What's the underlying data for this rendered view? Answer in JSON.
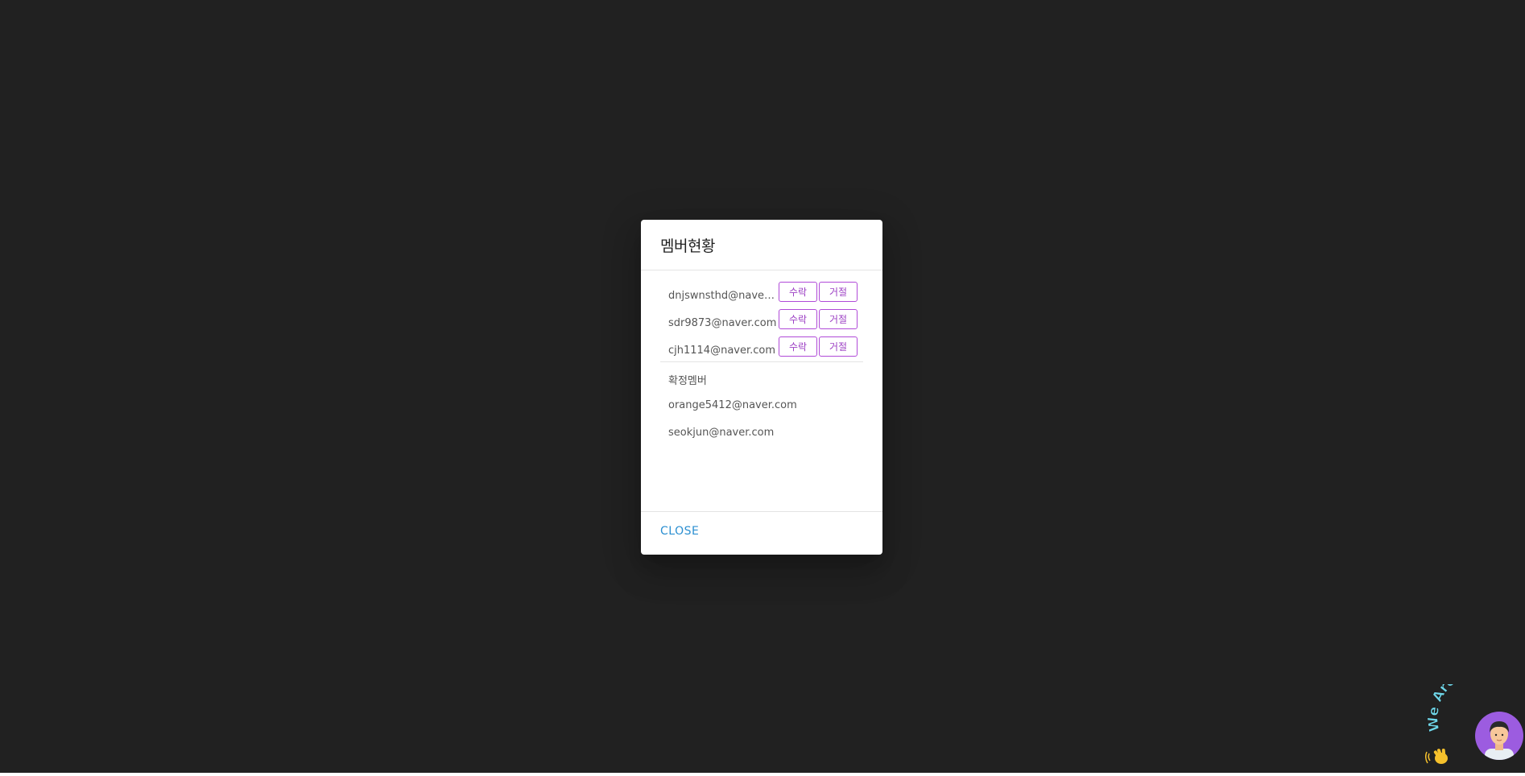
{
  "dialog": {
    "title": "멤버현황",
    "pending_members": [
      {
        "email": "dnjswnsthd@naver.com",
        "accept_label": "수락",
        "reject_label": "거절"
      },
      {
        "email": "sdr9873@naver.com",
        "accept_label": "수락",
        "reject_label": "거절"
      },
      {
        "email": "cjh1114@naver.com",
        "accept_label": "수락",
        "reject_label": "거절"
      }
    ],
    "confirmed_heading": "확정멤버",
    "confirmed_members": [
      "orange5412@naver.com",
      "seokjun@naver.com"
    ],
    "close_label": "CLOSE"
  },
  "widget": {
    "tagline": "We Are Here!",
    "wave_icon": "waving-hand-icon",
    "avatar_icon": "person-avatar-icon"
  },
  "colors": {
    "backdrop": "#212121",
    "accent_purple": "#b04ad8",
    "close_blue": "#2b8fd1"
  }
}
